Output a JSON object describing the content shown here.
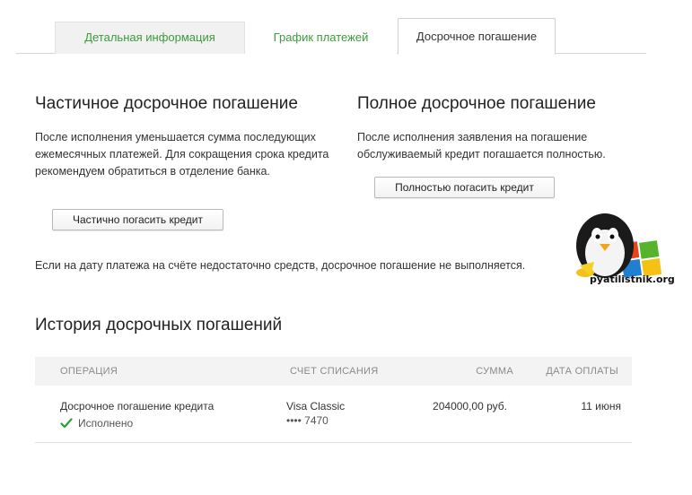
{
  "tabs": [
    {
      "label": "Детальная информация"
    },
    {
      "label": "График платежей"
    },
    {
      "label": "Досрочное погашение"
    }
  ],
  "partial": {
    "title": "Частичное досрочное погашение",
    "text": "После исполнения уменьшается сумма последующих ежемесячных платежей. Для сокращения срока кредита рекомендуем обратиться в отделение банка.",
    "button": "Частично погасить кредит"
  },
  "full": {
    "title": "Полное досрочное погашение",
    "text": "После исполнения заявления на погашение обслуживаемый кредит погашается полностью.",
    "button": "Полностью погасить кредит"
  },
  "note": "Если на дату платежа на счёте недостаточно средств, досрочное погашение не выполняется.",
  "history": {
    "title": "История досрочных погашений",
    "columns": {
      "operation": "ОПЕРАЦИЯ",
      "account": "СЧЕТ СПИСАНИЯ",
      "sum": "СУММА",
      "date": "ДАТА ОПЛАТЫ"
    },
    "rows": [
      {
        "operation": "Досрочное погашение кредита",
        "status": "Исполнено",
        "card": "Visa Classic",
        "card_number": "•••• 7470",
        "sum": "204000,00 руб.",
        "date": "11 июня"
      }
    ]
  },
  "watermark": {
    "text": "pyatilistnik.org"
  },
  "colors": {
    "accent": "#3a9c3a",
    "check": "#2e9e3a"
  }
}
